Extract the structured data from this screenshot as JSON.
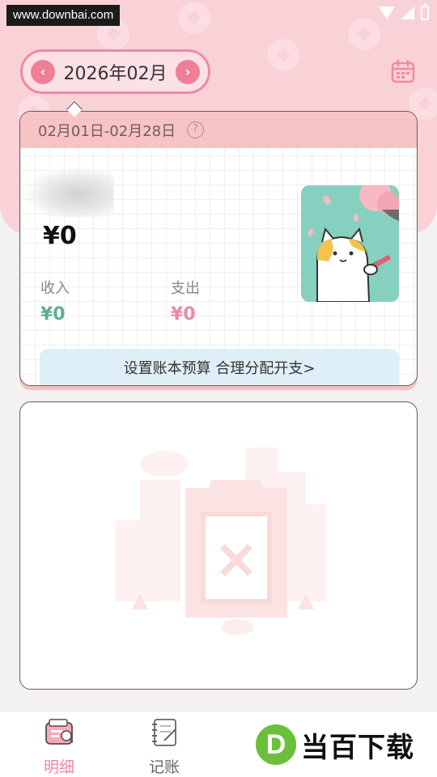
{
  "watermark": {
    "text": "www.downbai.com"
  },
  "header": {
    "month": "2026年02月",
    "prev_icon": "chevron-left-icon",
    "next_icon": "chevron-right-icon",
    "calendar_icon": "calendar-icon"
  },
  "summary": {
    "date_range": "02月01日-02月28日",
    "help_symbol": "?",
    "balance": "¥0",
    "income_label": "收入",
    "income_value": "¥0",
    "expense_label": "支出",
    "expense_value": "¥0",
    "budget_prompt": "设置账本预算 合理分配开支>"
  },
  "nav": {
    "items": [
      {
        "label": "明细",
        "icon": "wallet-icon",
        "active": true
      },
      {
        "label": "记账",
        "icon": "notebook-icon",
        "active": false
      }
    ]
  },
  "brand": {
    "logo_letter": "D",
    "text": "当百下载"
  },
  "colors": {
    "accent_pink": "#ef7f97",
    "income_green": "#5fae96",
    "expense_pink": "#e98aa5",
    "header_bg": "#f9d2d8",
    "budget_bg": "#dfeff7"
  }
}
